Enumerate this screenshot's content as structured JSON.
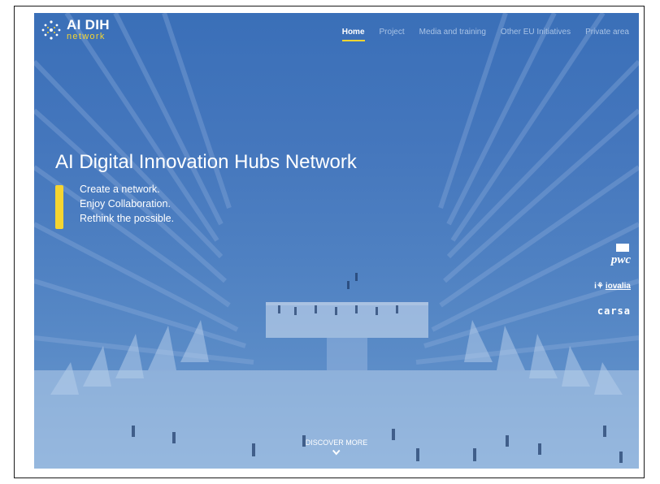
{
  "brand": {
    "title": "AI DIH",
    "subtitle": "network",
    "logo_icon": "network-dots-icon"
  },
  "nav": {
    "items": [
      {
        "label": "Home",
        "active": true
      },
      {
        "label": "Project",
        "active": false
      },
      {
        "label": "Media and training",
        "active": false
      },
      {
        "label": "Other EU Initiatives",
        "active": false
      },
      {
        "label": "Private area",
        "active": false
      }
    ]
  },
  "hero": {
    "headline": "AI Digital Innovation Hubs Network",
    "taglines": [
      "Create a network.",
      "Enjoy Collaboration.",
      "Rethink the possible."
    ],
    "discover_label": "DISCOVER MORE",
    "discover_icon": "chevron-down-icon"
  },
  "partners": [
    {
      "name": "pwc"
    },
    {
      "name": "iovalia"
    },
    {
      "name": "carsa"
    }
  ],
  "colors": {
    "accent": "#f5d531",
    "hero_blue": "#4577bd"
  }
}
